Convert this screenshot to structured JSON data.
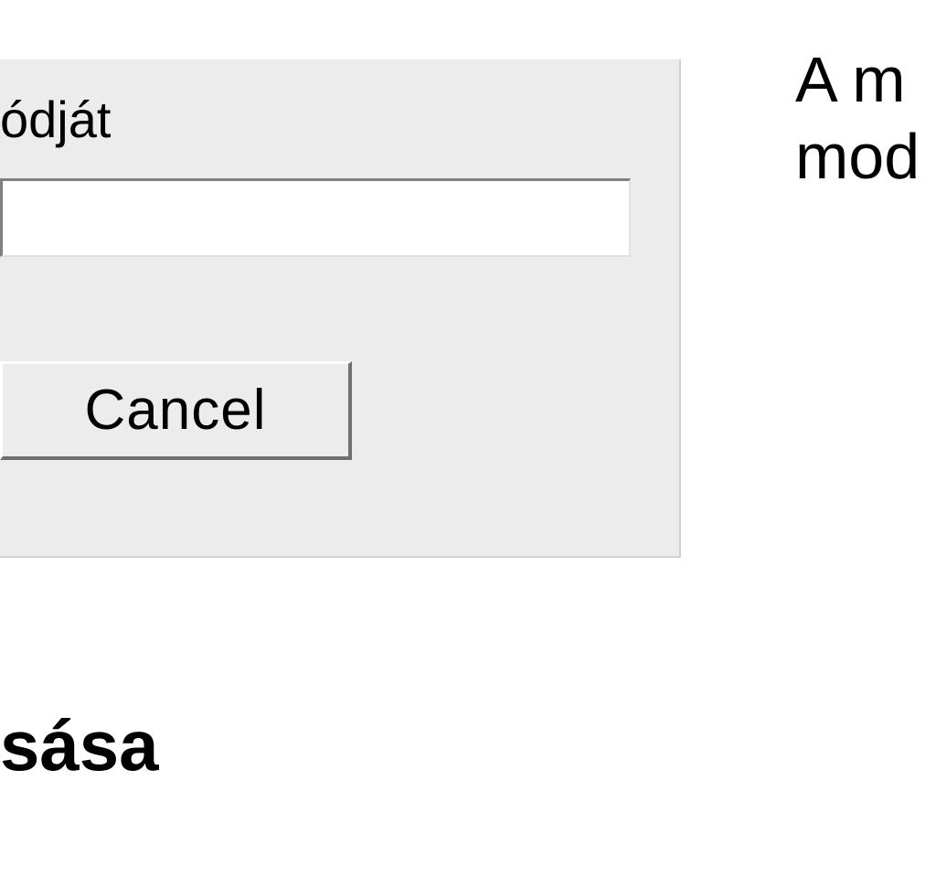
{
  "dialog": {
    "label_fragment": "ódját",
    "input_value": "",
    "cancel_label": "Cancel"
  },
  "right": {
    "line1": "A m",
    "line2": "mod"
  },
  "bottom": {
    "heading_fragment": "sása"
  }
}
